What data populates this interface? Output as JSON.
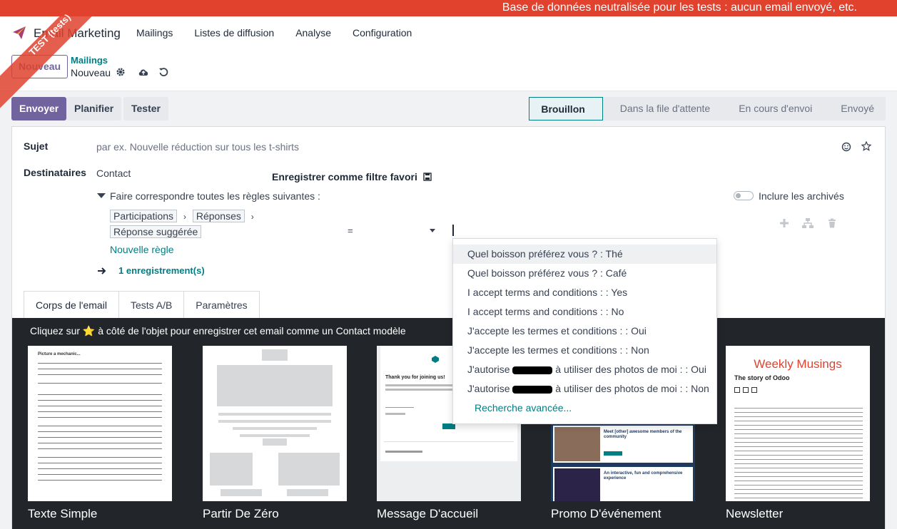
{
  "banner": {
    "text": "Base de données neutralisée pour les tests : aucun email envoyé, etc."
  },
  "ribbon": {
    "text": "TEST (tests)"
  },
  "navbar": {
    "app_name": "Email Marketing",
    "menu": [
      "Mailings",
      "Listes de diffusion",
      "Analyse",
      "Configuration"
    ]
  },
  "control_panel": {
    "new_button": "Nouveau",
    "breadcrumb_parent": "Mailings",
    "breadcrumb_current": "Nouveau"
  },
  "actions": {
    "send": "Envoyer",
    "schedule": "Planifier",
    "test": "Tester"
  },
  "status": {
    "stages": [
      "Brouillon",
      "Dans la file d'attente",
      "En cours d'envoi",
      "Envoyé"
    ],
    "active": "Brouillon"
  },
  "form": {
    "subject_label": "Sujet",
    "subject_placeholder": "par ex. Nouvelle réduction sur tous les t-shirts",
    "recipients_label": "Destinataires",
    "recipients_model": "Contact",
    "save_filter": "Enregistrer comme filtre favori",
    "match_all": "Faire correspondre toutes les règles suivantes :",
    "include_archived": "Inclure les archivés",
    "rule_path": [
      "Participations",
      "Réponses",
      "Réponse suggérée"
    ],
    "rule_operator": "=",
    "new_rule": "Nouvelle règle",
    "record_count": "1 enregistrement(s)"
  },
  "tabs": [
    "Corps de l'email",
    "Tests A/B",
    "Paramètres"
  ],
  "body": {
    "hint": "Cliquez sur ⭐ à côté de l'objet pour enregistrer cet email comme un Contact modèle",
    "templates": [
      "Texte Simple",
      "Partir De Zéro",
      "Message D'accueil",
      "Promo D'événement",
      "Newsletter"
    ],
    "newsletter_title": "Weekly Musings",
    "newsletter_subtitle": "The story of Odoo",
    "welcome_heading": "Thank you for joining us!",
    "plain_heading": "Picture a mechanic...",
    "event_heading": "Meet [other] awesome members of the community",
    "event_heading2": "An interactive, fun and comprehensive experience"
  },
  "dropdown": {
    "items": [
      {
        "pre": "Quel boisson préférez vous ? : Thé",
        "post": ""
      },
      {
        "pre": "Quel boisson préférez vous ? : Café",
        "post": ""
      },
      {
        "pre": "I accept terms and conditions : : Yes",
        "post": ""
      },
      {
        "pre": "I accept terms and conditions : : No",
        "post": ""
      },
      {
        "pre": "J'accepte les termes et conditions : : Oui",
        "post": ""
      },
      {
        "pre": "J'accepte les termes et conditions : : Non",
        "post": ""
      },
      {
        "pre": "J'autorise",
        "post": "à utiliser des photos de moi : : Oui"
      },
      {
        "pre": "J'autorise",
        "post": "à utiliser des photos de moi : : Non"
      }
    ],
    "advanced": "Recherche avancée..."
  }
}
